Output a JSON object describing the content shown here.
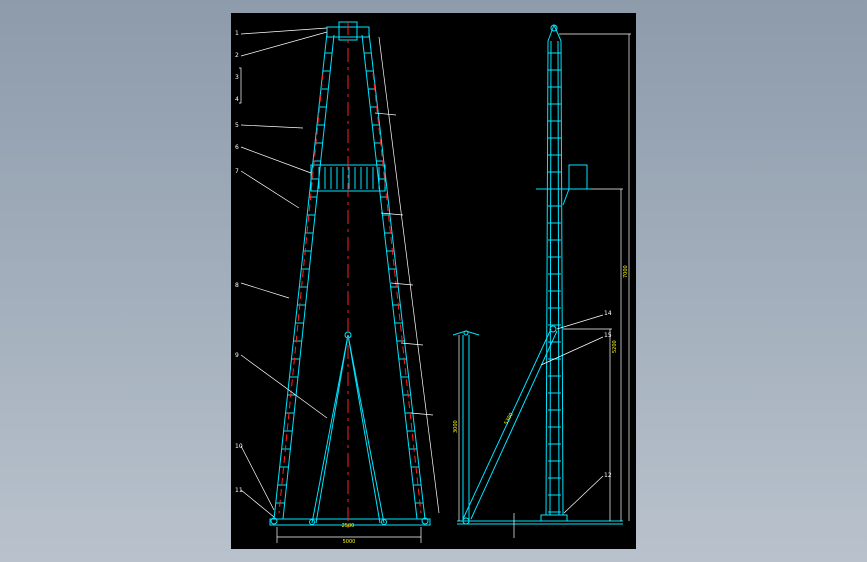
{
  "palette": {
    "background": "#000000",
    "structure": "#00e5ff",
    "centerline": "#ff2020",
    "leader": "#ffffff",
    "dimension_text": "#ffff00"
  },
  "callouts": {
    "left_view": [
      "1",
      "2",
      "3",
      "4",
      "5",
      "6",
      "7",
      "8",
      "9",
      "10",
      "11"
    ],
    "side_view": [
      "14",
      "15",
      "12"
    ]
  },
  "dimensions": {
    "base_width": "5000",
    "base_center": "2500",
    "mast_height": "7000",
    "mid_height": "5200",
    "strut_length": "5300",
    "small_post": "3000"
  }
}
